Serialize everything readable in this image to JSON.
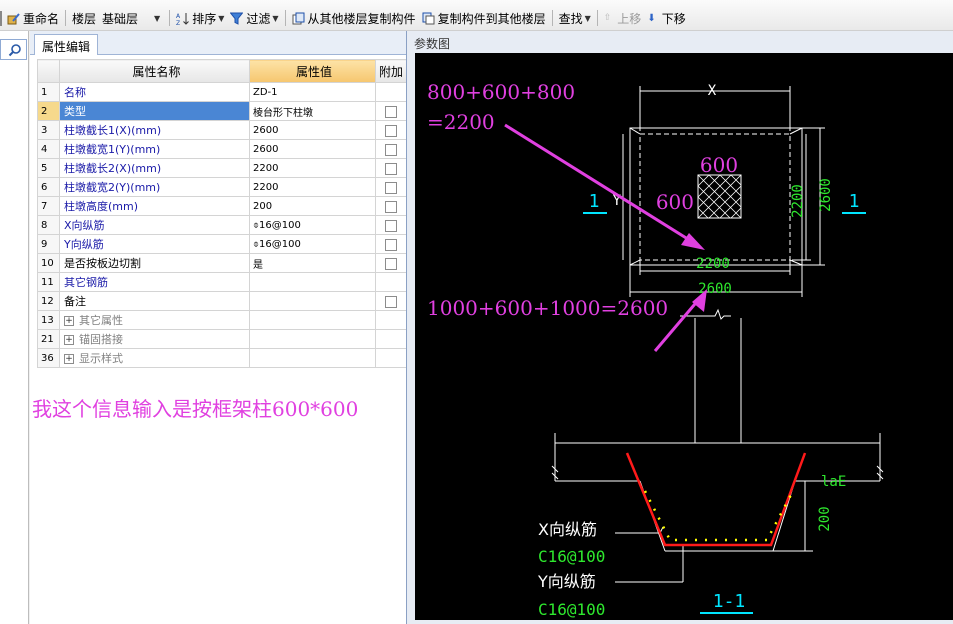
{
  "toolbar": {
    "rename": "重命名",
    "floor_label": "楼层",
    "floor_value": "基础层",
    "sort": "排序",
    "filter": "过滤",
    "copy_from_floor": "从其他楼层复制构件",
    "copy_to_floor": "复制构件到其他楼层",
    "find": "查找",
    "move_up": "上移",
    "move_down": "下移"
  },
  "panel": {
    "tab": "属性编辑",
    "headers": {
      "name": "属性名称",
      "value": "属性值",
      "extra": "附加"
    },
    "rows": [
      {
        "idx": "1",
        "name": "名称",
        "value": "ZD-1",
        "blue": true,
        "check": false,
        "selected": false
      },
      {
        "idx": "2",
        "name": "类型",
        "value": "棱台形下柱墩",
        "blue": true,
        "check": true,
        "selected": true
      },
      {
        "idx": "3",
        "name": "柱墩截长1(X)(mm)",
        "value": "2600",
        "blue": true,
        "check": true,
        "selected": false
      },
      {
        "idx": "4",
        "name": "柱墩截宽1(Y)(mm)",
        "value": "2600",
        "blue": true,
        "check": true,
        "selected": false
      },
      {
        "idx": "5",
        "name": "柱墩截长2(X)(mm)",
        "value": "2200",
        "blue": true,
        "check": true,
        "selected": false
      },
      {
        "idx": "6",
        "name": "柱墩截宽2(Y)(mm)",
        "value": "2200",
        "blue": true,
        "check": true,
        "selected": false
      },
      {
        "idx": "7",
        "name": "柱墩高度(mm)",
        "value": "200",
        "blue": true,
        "check": true,
        "selected": false
      },
      {
        "idx": "8",
        "name": "X向纵筋",
        "value": "⌽16@100",
        "blue": true,
        "check": true,
        "selected": false
      },
      {
        "idx": "9",
        "name": "Y向纵筋",
        "value": "⌽16@100",
        "blue": true,
        "check": true,
        "selected": false
      },
      {
        "idx": "10",
        "name": "是否按板边切割",
        "value": "是",
        "blue": false,
        "check": true,
        "selected": false
      },
      {
        "idx": "11",
        "name": "其它钢筋",
        "value": "",
        "blue": true,
        "check": false,
        "selected": false
      },
      {
        "idx": "12",
        "name": "备注",
        "value": "",
        "blue": false,
        "check": true,
        "selected": false
      }
    ],
    "groups": [
      {
        "idx": "13",
        "name": "其它属性"
      },
      {
        "idx": "21",
        "name": "锚固搭接"
      },
      {
        "idx": "36",
        "name": "显示样式"
      }
    ],
    "note": "我这个信息输入是按框架柱600*600"
  },
  "diagram": {
    "title": "参数图",
    "labels": {
      "dim_x": "X",
      "dim_y": "Y",
      "col_600_top": "600",
      "col_600_left": "600",
      "inner_2200_h": "2200",
      "outer_2600_h": "2600",
      "inner_2200_v": "2200",
      "outer_2600_v": "2600",
      "section_left": "1",
      "section_right": "1",
      "lae": "laE",
      "height_200": "200",
      "x_bar_label": "X向纵筋",
      "x_bar_spec": "C16@100",
      "y_bar_label": "Y向纵筋",
      "y_bar_spec": "C16@100",
      "section_title": "1-1"
    },
    "annotations": {
      "calc_inner_1": "800+600+800",
      "calc_inner_2": "=2200",
      "calc_outer": "1000+600+1000=2600"
    },
    "colors": {
      "drawing_line": "#ffffff",
      "dimension_green": "#2ee82e",
      "annotation_magenta": "#e040e0",
      "section_cyan": "#00e5ff",
      "rebar_red": "#ff1a1a",
      "rebar_dots": "#ffff00"
    }
  }
}
